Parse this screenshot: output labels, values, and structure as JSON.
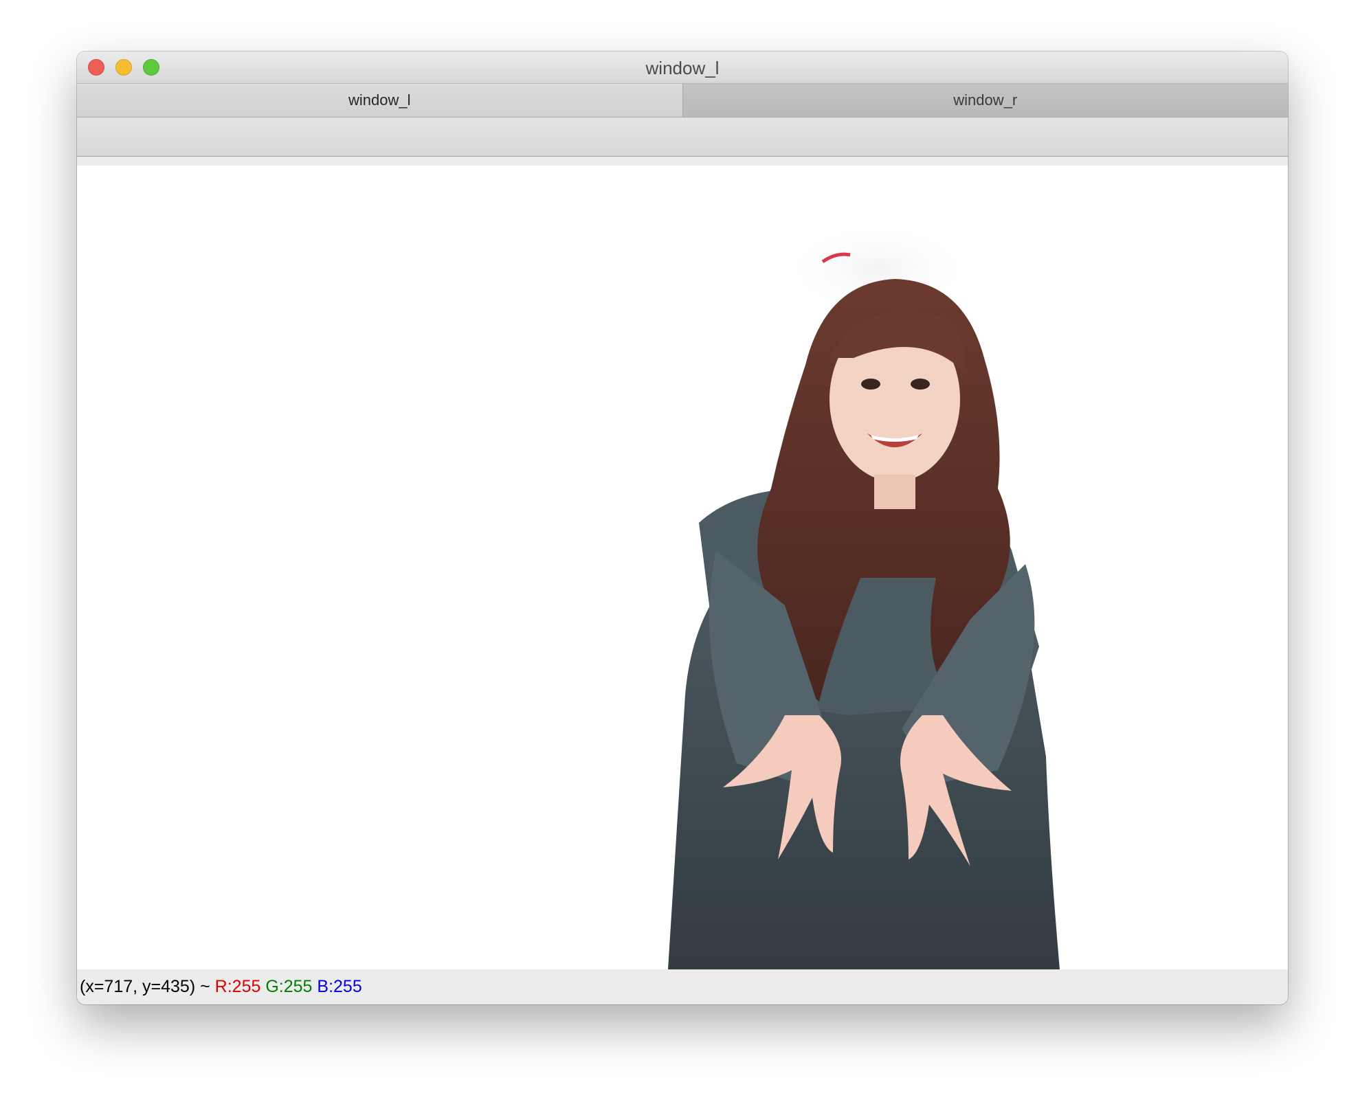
{
  "window": {
    "title": "window_l"
  },
  "tabs": [
    {
      "label": "window_l",
      "active": true
    },
    {
      "label": "window_r",
      "active": false
    }
  ],
  "status": {
    "coords": "(x=717, y=435) ~",
    "r": "R:255",
    "g": "G:255",
    "b": "B:255",
    "colors": {
      "r": "#e00000",
      "g": "#008000",
      "b": "#0000e0"
    }
  },
  "image": {
    "description_icon": "photo-woman-reaching-out"
  }
}
